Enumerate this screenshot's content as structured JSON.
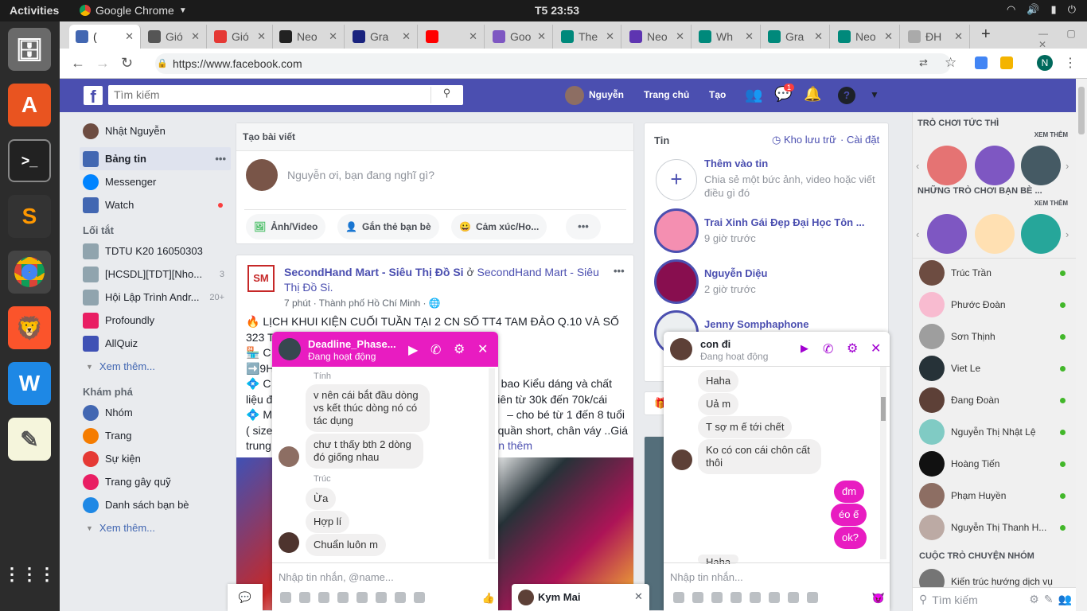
{
  "system": {
    "activities": "Activities",
    "app": "Google Chrome",
    "clock": "T5 23:53"
  },
  "tabs": [
    {
      "label": "(",
      "color": "#4267b2"
    },
    {
      "label": "Gió",
      "color": "#555"
    },
    {
      "label": "Gió",
      "color": "#e53935"
    },
    {
      "label": "Neo",
      "color": "#222"
    },
    {
      "label": "Gra",
      "color": "#1a237e"
    },
    {
      "label": "",
      "color": "#f00"
    },
    {
      "label": "Goo",
      "color": "#7e57c2"
    },
    {
      "label": "The",
      "color": "#00897b"
    },
    {
      "label": "Neo",
      "color": "#5e35b1"
    },
    {
      "label": "Wh",
      "color": "#00897b"
    },
    {
      "label": "Gra",
      "color": "#00897b"
    },
    {
      "label": "Neo",
      "color": "#00897b"
    },
    {
      "label": "ĐH",
      "color": "#aaa"
    }
  ],
  "address": {
    "url": "https://www.facebook.com"
  },
  "fb": {
    "search_placeholder": "Tìm kiếm",
    "user": "Nguyễn",
    "home": "Trang chủ",
    "create": "Tạo",
    "msg_badge": "1"
  },
  "leftnav": {
    "user": "Nhật Nguyễn",
    "items": [
      "Bảng tin",
      "Messenger",
      "Watch"
    ],
    "shortcuts_title": "Lối tắt",
    "shortcuts": [
      {
        "label": "TDTU K20 16050303",
        "count": ""
      },
      {
        "label": "[HCSDL][TDT][Nho...",
        "count": "3"
      },
      {
        "label": "Hội Lập Trình Andr...",
        "count": "20+"
      },
      {
        "label": "Profoundly",
        "count": ""
      },
      {
        "label": "AllQuiz",
        "count": ""
      }
    ],
    "see_more": "Xem thêm...",
    "explore_title": "Khám phá",
    "explore": [
      "Nhóm",
      "Trang",
      "Sự kiện",
      "Trang gây quỹ",
      "Danh sách bạn bè"
    ],
    "see_more2": "Xem thêm..."
  },
  "composer": {
    "title": "Tạo bài viết",
    "placeholder": "Nguyễn ơi, bạn đang nghĩ gì?",
    "actions": [
      "Ảnh/Video",
      "Gắn thẻ bạn bè",
      "Cảm xúc/Ho..."
    ]
  },
  "post": {
    "page": "SecondHand Mart - Siêu Thị Đồ Si",
    "at": " ở ",
    "page2": "SecondHand Mart - Siêu Thị Đồ Si.",
    "meta": "7 phút · Thành phố Hồ Chí Minh ·",
    "line1": "🔥 LỊCH KHUI KIỆN CUỐI TUẦN TẠI 2 CN SỐ TT4 TAM ĐẢO Q.10 VÀ SỐ",
    "line2": "323 T",
    "line3": "🏪 C",
    "line4": "➡️9H",
    "line5": "💠 C",
    "line5b": "bao Kiểu dáng và chất",
    "line6": "liệu đ",
    "line6b": "iên từ 30k đến 70k/cái",
    "line7": "💠 M",
    "line7b": "– cho bé từ 1 đến 8 tuổi",
    "line8": "( size",
    "line8b": "quần short, chân váy ..Giá",
    "line9": "trung",
    "line9b": "n thêm"
  },
  "stories": {
    "title": "Tin",
    "archive": "Kho lưu trữ",
    "settings": "Cài đặt",
    "add_title": "Thêm vào tin",
    "add_desc": "Chia sẻ một bức ảnh, video hoặc viết điều gì đó",
    "items": [
      {
        "name": "Trai Xinh Gái Đẹp Đại Học Tôn ...",
        "time": "9 giờ trước"
      },
      {
        "name": "Nguyễn Diệu",
        "time": "2 giờ trước"
      },
      {
        "name": "Jenny Somphaphone",
        "time": ""
      }
    ]
  },
  "right": {
    "games_title": "TRÒ CHƠI TỨC THÌ",
    "see_all": "XEM THÊM",
    "friends_games": "NHỮNG TRÒ CHƠI BẠN BÈ ...",
    "see_all2": "XEM THÊM",
    "friends": [
      "Trúc Trần",
      "Phước Đoàn",
      "Sơn Thịnh",
      "Viet Le",
      "Đang Đoàn",
      "Nguyễn Thị Nhật Lệ",
      "Hoàng Tiến",
      "Phạm Huyền",
      "Nguyễn Thị Thanh H..."
    ],
    "groups_title": "CUỘC TRÒ CHUYỆN NHÓM",
    "group1": "Kiến trúc hướng dịch vụ",
    "search": "Tìm kiếm"
  },
  "chat1": {
    "name": "Deadline_Phase...",
    "status": "Đang hoạt động",
    "sender1": "Tính",
    "m1": "v nên cái bắt đầu dòng vs kết thúc dòng nó có tác dụng",
    "m2": "chư t thấy bth 2 dòng đó giống nhau",
    "sender2": "Trúc",
    "m3": "Ừa",
    "m4": "Hợp lí",
    "m5": "Chuẩn luôn m",
    "input": "Nhập tin nhắn, @name..."
  },
  "chat2": {
    "name": "con đi",
    "status": "Đang hoạt động",
    "m1": "Haha",
    "m2": "Uả m",
    "m3": "T sợ m ế tới chết",
    "m4": "Ko có con cái chôn cất thôi",
    "me1": "đm",
    "me2": "éo ế",
    "me3": "ok?",
    "m5": "Haha",
    "input": "Nhập tin nhắn..."
  },
  "chat3": {
    "name": "Kym Mai"
  }
}
